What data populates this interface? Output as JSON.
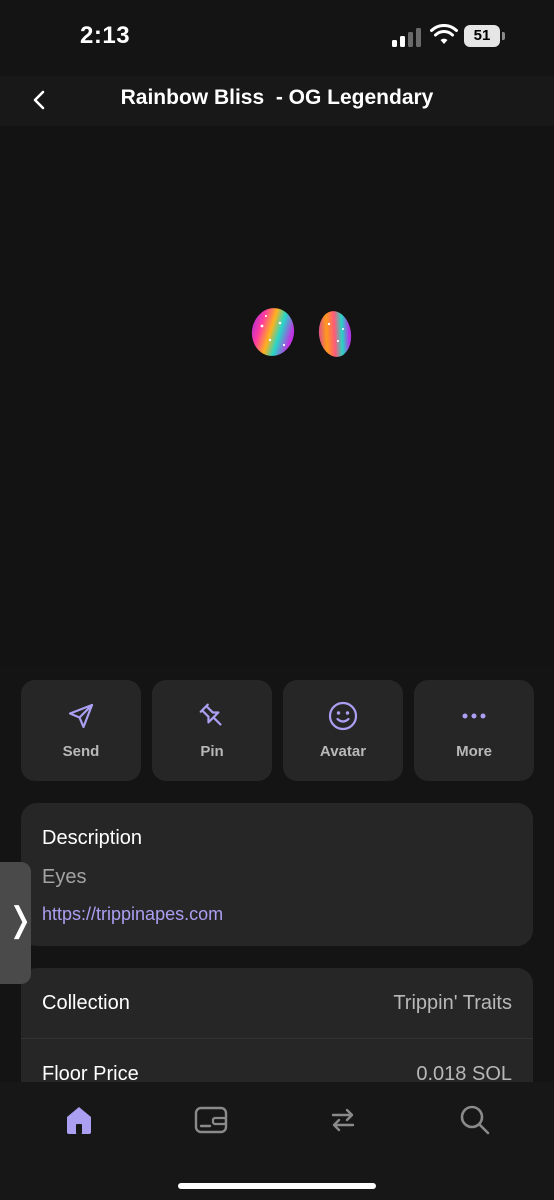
{
  "status_bar": {
    "time": "2:13",
    "battery": "51"
  },
  "header": {
    "title": "Rainbow Bliss  - OG Legendary"
  },
  "actions": [
    {
      "label": "Send",
      "icon": "send-icon"
    },
    {
      "label": "Pin",
      "icon": "pin-icon"
    },
    {
      "label": "Avatar",
      "icon": "smiley-icon"
    },
    {
      "label": "More",
      "icon": "more-dots-icon"
    }
  ],
  "description": {
    "heading": "Description",
    "text": "Eyes",
    "link": "https://trippinapes.com"
  },
  "info": {
    "collection_label": "Collection",
    "collection_value": "Trippin' Traits",
    "floor_label": "Floor Price",
    "floor_value": "0.018 SOL"
  },
  "side_tab": {
    "glyph": "❭"
  },
  "tab_bar": {
    "items": [
      "home-icon",
      "wallet-icon",
      "swap-icon",
      "search-icon"
    ],
    "active": "home-icon"
  },
  "colors": {
    "accent": "#ab9ff2",
    "background": "#141414",
    "card": "#262626"
  }
}
